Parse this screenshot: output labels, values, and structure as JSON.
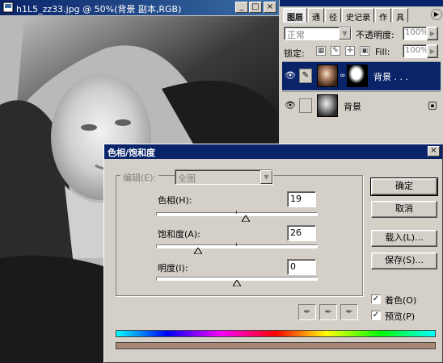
{
  "document": {
    "title": "h1L5_zz33.jpg @ 50%(背景 副本,RGB)",
    "buttons": {
      "minimize": "_",
      "maximize": "□",
      "close": "×"
    }
  },
  "layers_palette": {
    "tabs": [
      {
        "label": "图层"
      },
      {
        "label": "通"
      },
      {
        "label": "径"
      },
      {
        "label": "史记录"
      },
      {
        "label": "作"
      },
      {
        "label": "具"
      }
    ],
    "blend_mode": "正常",
    "opacity_label": "不透明度:",
    "opacity_value": "100%",
    "lock_label": "锁定:",
    "fill_label": "Fill:",
    "fill_value": "100%",
    "layers": [
      {
        "name": "背景 . . .",
        "selected": true,
        "visible": true,
        "has_mask": true
      },
      {
        "name": "背景",
        "selected": false,
        "visible": true,
        "locked": true
      }
    ]
  },
  "hue_saturation_dialog": {
    "title": "色相/饱和度",
    "close": "×",
    "edit_label": "编辑(E):",
    "edit_value": "全图",
    "hue": {
      "label": "色相(H):",
      "value": "19",
      "min": -180,
      "max": 180
    },
    "saturation": {
      "label": "饱和度(A):",
      "value": "26",
      "min": 0,
      "max": 100
    },
    "lightness": {
      "label": "明度(I):",
      "value": "0",
      "min": -100,
      "max": 100
    },
    "buttons": {
      "ok": "确定",
      "cancel": "取消",
      "load": "载入(L)...",
      "save": "保存(S)..."
    },
    "colorize": {
      "label": "着色(O)",
      "checked": true
    },
    "preview": {
      "label": "预览(P)",
      "checked": true
    },
    "colors": {
      "result_color": "#a98878",
      "title_bar": "#0a246a"
    }
  }
}
